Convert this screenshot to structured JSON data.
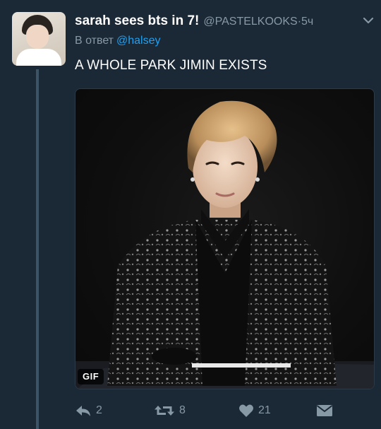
{
  "tweet": {
    "display_name": "sarah sees bts in 7!",
    "handle": "@PASTELKOOKS",
    "separator": "·",
    "time": "5ч",
    "reply_prefix": "В ответ",
    "reply_to": "@halsey",
    "text": "A WHOLE PARK JIMIN EXISTS",
    "media_badge": "GIF"
  },
  "actions": {
    "reply_count": "2",
    "retweet_count": "8",
    "like_count": "21"
  },
  "icons": {
    "reply": "reply-icon",
    "retweet": "retweet-icon",
    "like": "heart-icon",
    "dm": "envelope-icon",
    "menu": "chevron-down-icon"
  },
  "colors": {
    "background": "#1b2836",
    "muted": "#8899a6",
    "link": "#1da1f2",
    "thread_line": "#3d5466"
  }
}
